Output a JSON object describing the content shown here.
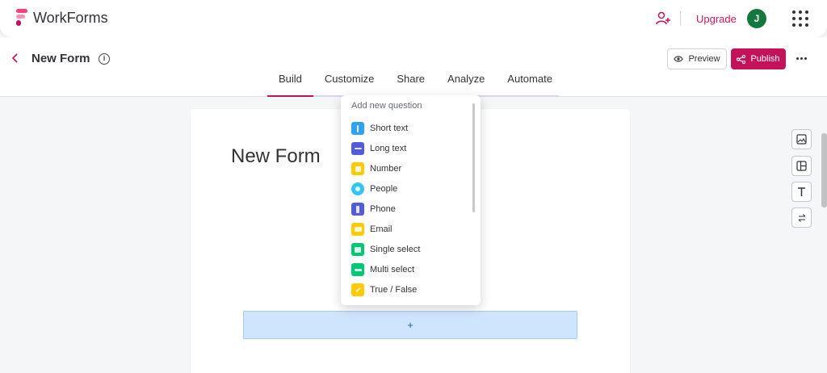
{
  "app": {
    "name": "WorkForms",
    "upgrade_label": "Upgrade",
    "avatar_initial": "J"
  },
  "form": {
    "header_title": "New Form",
    "canvas_title": "New Form",
    "add_symbol": "+"
  },
  "actions": {
    "preview_label": "Preview",
    "publish_label": "Publish"
  },
  "tabs": [
    {
      "label": "Build",
      "active": true
    },
    {
      "label": "Customize"
    },
    {
      "label": "Share"
    },
    {
      "label": "Analyze"
    },
    {
      "label": "Automate"
    }
  ],
  "menu": {
    "header": "Add new question",
    "items": [
      {
        "label": "Short text",
        "color": "#2fa2f3",
        "icon": "short-text-icon"
      },
      {
        "label": "Long text",
        "color": "#5559df",
        "icon": "long-text-icon"
      },
      {
        "label": "Number",
        "color": "#ffcb00",
        "icon": "number-icon"
      },
      {
        "label": "People",
        "color": "#33c4f2",
        "icon": "people-icon"
      },
      {
        "label": "Phone",
        "color": "#5559df",
        "icon": "phone-icon"
      },
      {
        "label": "Email",
        "color": "#ffcb00",
        "icon": "email-icon"
      },
      {
        "label": "Single select",
        "color": "#00c875",
        "icon": "single-select-icon"
      },
      {
        "label": "Multi select",
        "color": "#00c875",
        "icon": "multi-select-icon"
      },
      {
        "label": "True / False",
        "color": "#ffcb00",
        "icon": "true-false-icon"
      }
    ]
  },
  "colors": {
    "brand": "#c3125a",
    "avatar": "#13783d",
    "add_bar": "#cfe5fd"
  },
  "side_tools": [
    "image-icon",
    "layout-icon",
    "text-icon",
    "transfer-icon"
  ]
}
